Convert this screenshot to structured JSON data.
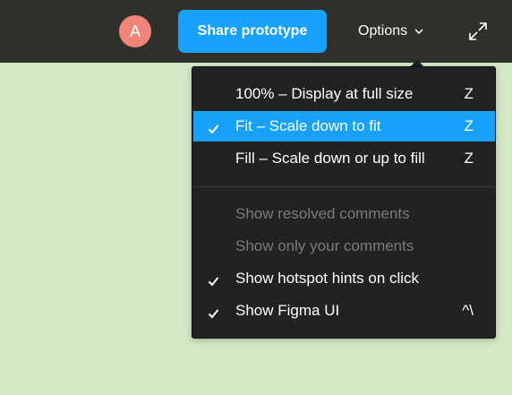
{
  "header": {
    "avatar_initial": "A",
    "avatar_color": "#f08479",
    "share_label": "Share prototype",
    "options_label": "Options",
    "background_color": "#2f3029",
    "accent_color": "#18a0fb"
  },
  "canvas": {
    "background_color": "#d5e9c6"
  },
  "menu": {
    "sections": [
      {
        "items": [
          {
            "label": "100% – Display at full size",
            "shortcut": "Z",
            "checked": false,
            "selected": false,
            "disabled": false
          },
          {
            "label": "Fit – Scale down to fit",
            "shortcut": "Z",
            "checked": true,
            "selected": true,
            "disabled": false
          },
          {
            "label": "Fill – Scale down or up to fill",
            "shortcut": "Z",
            "checked": false,
            "selected": false,
            "disabled": false
          }
        ]
      },
      {
        "items": [
          {
            "label": "Show resolved comments",
            "shortcut": "",
            "checked": false,
            "selected": false,
            "disabled": true
          },
          {
            "label": "Show only your comments",
            "shortcut": "",
            "checked": false,
            "selected": false,
            "disabled": true
          },
          {
            "label": "Show hotspot hints on click",
            "shortcut": "",
            "checked": true,
            "selected": false,
            "disabled": false
          },
          {
            "label": "Show Figma UI",
            "shortcut": "^\\",
            "checked": true,
            "selected": false,
            "disabled": false
          }
        ]
      }
    ]
  }
}
